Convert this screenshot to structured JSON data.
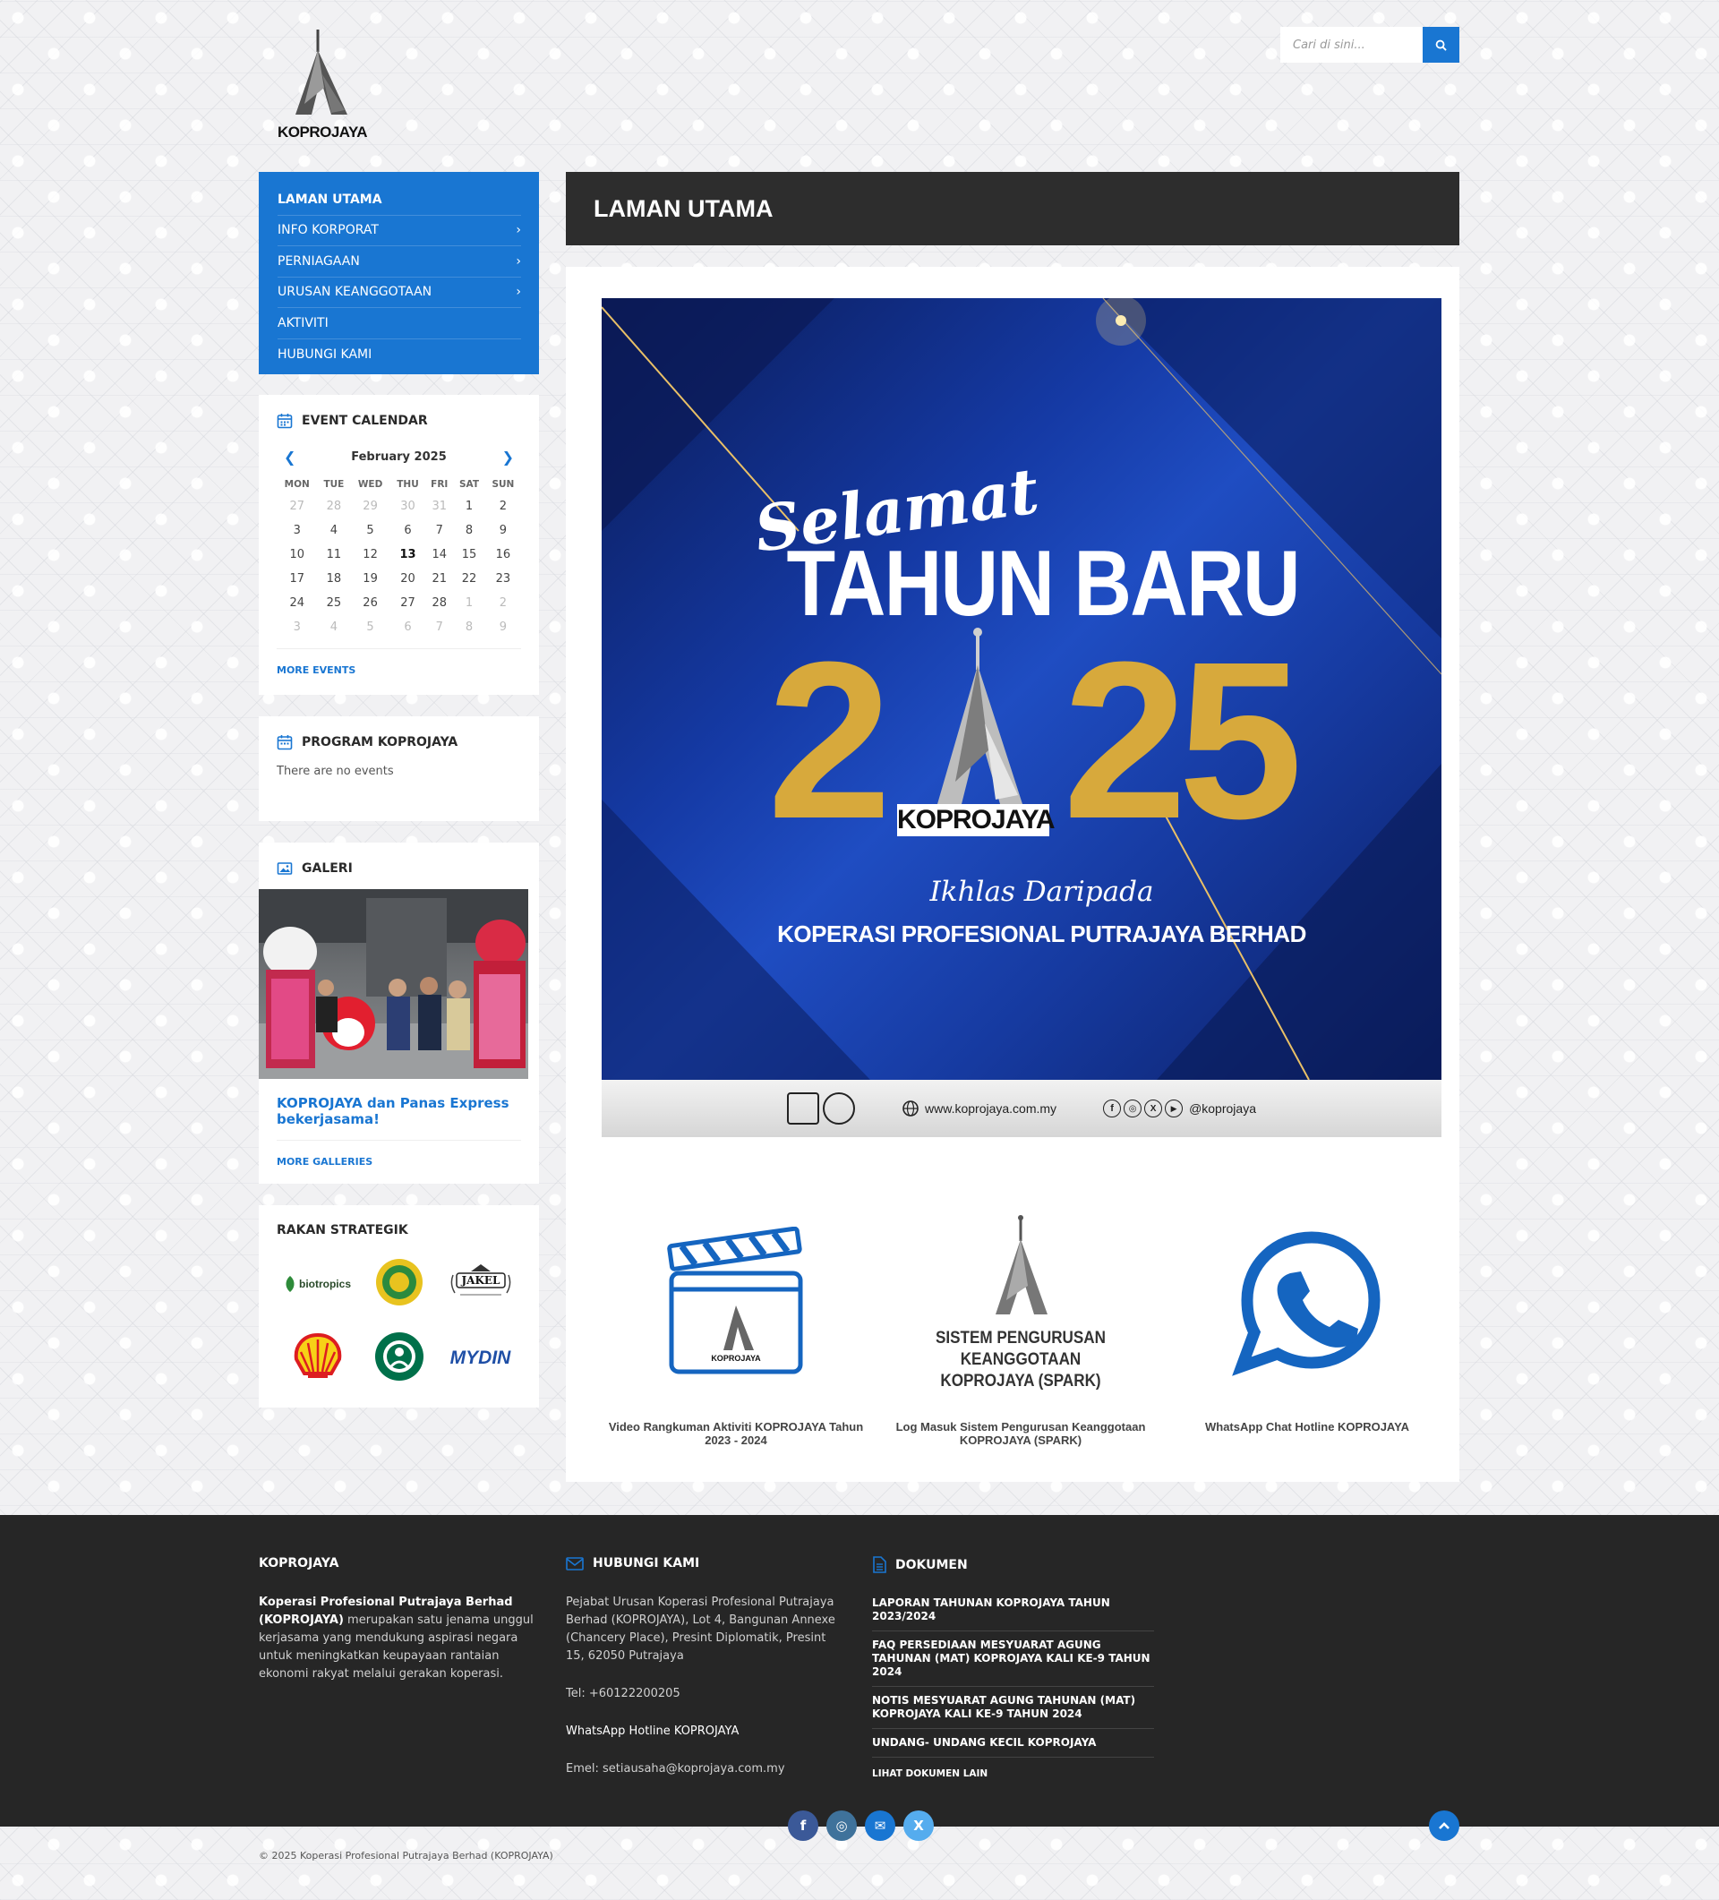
{
  "header": {
    "logo_text": "KOPROJAYA",
    "search_placeholder": "Cari di sini..."
  },
  "menu": [
    {
      "label": "LAMAN UTAMA",
      "has_sub": false,
      "active": true
    },
    {
      "label": "INFO KORPORAT",
      "has_sub": true
    },
    {
      "label": "PERNIAGAAN",
      "has_sub": true
    },
    {
      "label": "URUSAN KEANGGOTAAN",
      "has_sub": true
    },
    {
      "label": "AKTIVITI",
      "has_sub": false
    },
    {
      "label": "HUBUNGI KAMI",
      "has_sub": false
    }
  ],
  "calendar": {
    "title": "EVENT CALENDAR",
    "month": "February 2025",
    "days": [
      "MON",
      "TUE",
      "WED",
      "THU",
      "FRI",
      "SAT",
      "SUN"
    ],
    "weeks": [
      [
        "27",
        "28",
        "29",
        "30",
        "31",
        "1",
        "2"
      ],
      [
        "3",
        "4",
        "5",
        "6",
        "7",
        "8",
        "9"
      ],
      [
        "10",
        "11",
        "12",
        "13",
        "14",
        "15",
        "16"
      ],
      [
        "17",
        "18",
        "19",
        "20",
        "21",
        "22",
        "23"
      ],
      [
        "24",
        "25",
        "26",
        "27",
        "28",
        "1",
        "2"
      ],
      [
        "3",
        "4",
        "5",
        "6",
        "7",
        "8",
        "9"
      ]
    ],
    "today": "13",
    "more": "MORE EVENTS"
  },
  "program": {
    "title": "PROGRAM KOPROJAYA",
    "empty": "There are no events"
  },
  "gallery": {
    "title": "GALERI",
    "caption": "KOPROJAYA dan Panas Express bekerjasama!",
    "more": "MORE GALLERIES"
  },
  "partners": {
    "title": "RAKAN STRATEGIK",
    "logos": [
      "biotropics",
      "lembaga",
      "jakel",
      "shell",
      "starbucks",
      "mydin"
    ],
    "biotropics_text": "biotropics",
    "jakel_text": "JAKEL",
    "mydin_text": "MYDIN"
  },
  "page": {
    "title": "LAMAN UTAMA"
  },
  "banner": {
    "selamat": "Selamat",
    "tahun_baru": "TAHUN BARU",
    "year_left": "2",
    "year_right": "25",
    "brand": "KOPROJAYA",
    "ikhlas": "Ikhlas Daripada",
    "org": "KOPERASI PROFESIONAL PUTRAJAYA BERHAD",
    "website": "www.koprojaya.com.my",
    "handle": "@koprojaya"
  },
  "tiles": [
    {
      "caption": "Video Rangkuman Aktiviti KOPROJAYA Tahun 2023 - 2024"
    },
    {
      "caption": "Log Masuk Sistem Pengurusan Keanggotaan KOPROJAYA (SPARK)",
      "art_text": "SISTEM PENGURUSAN KEANGGOTAAN KOPROJAYA (SPARK)"
    },
    {
      "caption": "WhatsApp Chat Hotline KOPROJAYA"
    }
  ],
  "footer": {
    "col1": {
      "title": "KOPROJAYA",
      "bold": "Koperasi Profesional Putrajaya Berhad (KOPROJAYA)",
      "text": " merupakan satu jenama unggul kerjasama yang mendukung aspirasi negara untuk meningkatkan keupayaan rantaian ekonomi rakyat melalui gerakan koperasi."
    },
    "col2": {
      "title": "HUBUNGI KAMI",
      "address": "Pejabat Urusan Koperasi Profesional Putrajaya Berhad (KOPROJAYA), Lot 4, Bangunan Annexe (Chancery Place), Presint Diplomatik, Presint 15, 62050 Putrajaya",
      "tel": "Tel: +60122200205",
      "whatsapp": "WhatsApp Hotline KOPROJAYA",
      "email": "Emel: setiausaha@koprojaya.com.my"
    },
    "col3": {
      "title": "DOKUMEN",
      "docs": [
        "LAPORAN TAHUNAN KOPROJAYA TAHUN 2023/2024",
        "FAQ PERSEDIAAN MESYUARAT AGUNG TAHUNAN (MAT) KOPROJAYA KALI KE-9 TAHUN 2024",
        "NOTIS MESYUARAT AGUNG TAHUNAN (MAT) KOPROJAYA KALI KE-9 TAHUN 2024",
        "UNDANG- UNDANG KECIL KOPROJAYA"
      ],
      "more": "LIHAT DOKUMEN LAIN"
    },
    "social": [
      {
        "name": "facebook-icon",
        "glyph": "f",
        "color": "#3b5998"
      },
      {
        "name": "instagram-icon",
        "glyph": "◎",
        "color": "#3f729b"
      },
      {
        "name": "email-icon",
        "glyph": "✉",
        "color": "#1976d2"
      },
      {
        "name": "x-icon",
        "glyph": "X",
        "color": "#55acee"
      }
    ],
    "copyright": "© 2025 Koperasi Profesional Putrajaya Berhad (KOPROJAYA)"
  },
  "colors": {
    "brand_blue": "#1976d2",
    "dark": "#2d2d2d",
    "gold": "#d7a93c"
  }
}
